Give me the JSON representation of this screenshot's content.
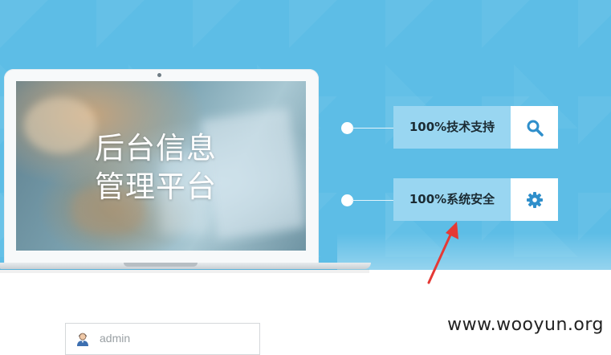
{
  "hero": {
    "screen_title_line1": "后台信息",
    "screen_title_line2": "管理平台",
    "background_color": "#5dbde6"
  },
  "features": [
    {
      "label": "100%技术支持",
      "icon": "search-icon"
    },
    {
      "label": "100%系统安全",
      "icon": "gear-icon"
    }
  ],
  "colors": {
    "accent": "#2f8fcb",
    "feature_label_bg": "#99d6f1",
    "annotation_arrow": "#e53935"
  },
  "login": {
    "username_value": "admin",
    "username_icon": "user-icon"
  },
  "watermark": "www.wooyun.org"
}
